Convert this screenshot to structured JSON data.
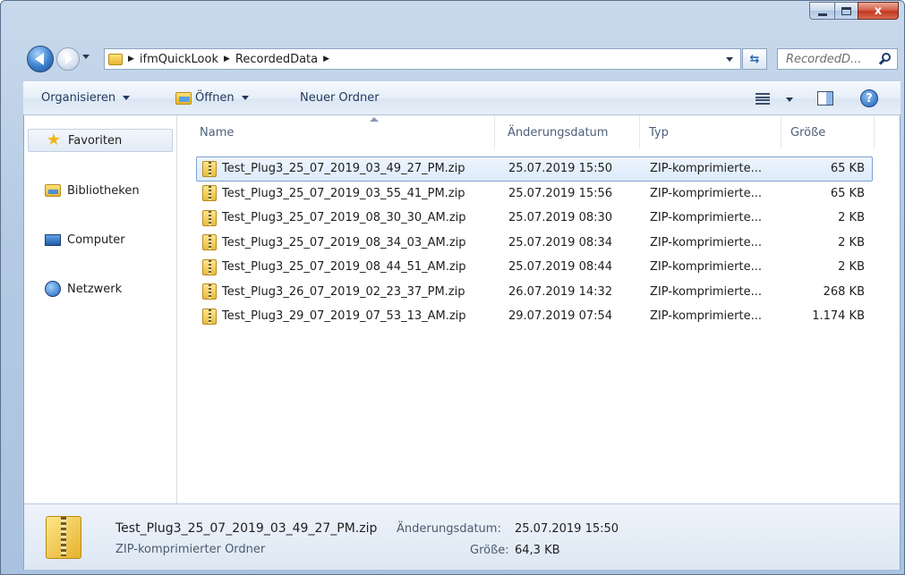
{
  "window": {
    "caption_close": "x"
  },
  "address_bar": {
    "crumbs": [
      "ifmQuickLook",
      "RecordedData"
    ],
    "search_placeholder": "RecordedD..."
  },
  "toolbar": {
    "organize_label": "Organisieren",
    "open_label": "Öffnen",
    "new_folder_label": "Neuer Ordner",
    "help_glyph": "?"
  },
  "nav_pane": {
    "items": [
      {
        "label": "Favoriten",
        "icon": "star-icon"
      },
      {
        "label": "Bibliotheken",
        "icon": "libraries-icon"
      },
      {
        "label": "Computer",
        "icon": "computer-icon"
      },
      {
        "label": "Netzwerk",
        "icon": "network-icon"
      }
    ]
  },
  "columns": {
    "name": "Name",
    "date": "Änderungsdatum",
    "type": "Typ",
    "size": "Größe"
  },
  "files": [
    {
      "name": "Test_Plug3_25_07_2019_03_49_27_PM.zip",
      "date": "25.07.2019 15:50",
      "type": "ZIP-komprimierte...",
      "size": "65 KB",
      "selected": true
    },
    {
      "name": "Test_Plug3_25_07_2019_03_55_41_PM.zip",
      "date": "25.07.2019 15:56",
      "type": "ZIP-komprimierte...",
      "size": "65 KB",
      "selected": false
    },
    {
      "name": "Test_Plug3_25_07_2019_08_30_30_AM.zip",
      "date": "25.07.2019 08:30",
      "type": "ZIP-komprimierte...",
      "size": "2 KB",
      "selected": false
    },
    {
      "name": "Test_Plug3_25_07_2019_08_34_03_AM.zip",
      "date": "25.07.2019 08:34",
      "type": "ZIP-komprimierte...",
      "size": "2 KB",
      "selected": false
    },
    {
      "name": "Test_Plug3_25_07_2019_08_44_51_AM.zip",
      "date": "25.07.2019 08:44",
      "type": "ZIP-komprimierte...",
      "size": "2 KB",
      "selected": false
    },
    {
      "name": "Test_Plug3_26_07_2019_02_23_37_PM.zip",
      "date": "26.07.2019 14:32",
      "type": "ZIP-komprimierte...",
      "size": "268 KB",
      "selected": false
    },
    {
      "name": "Test_Plug3_29_07_2019_07_53_13_AM.zip",
      "date": "29.07.2019 07:54",
      "type": "ZIP-komprimierte...",
      "size": "1.174 KB",
      "selected": false
    }
  ],
  "details": {
    "name": "Test_Plug3_25_07_2019_03_49_27_PM.zip",
    "type": "ZIP-komprimierter Ordner",
    "date_label": "Änderungsdatum:",
    "date_value": "25.07.2019 15:50",
    "size_label": "Größe:",
    "size_value": "64,3 KB"
  },
  "colors": {
    "selection_border": "#7da2ce",
    "frame": "#b5cbe4",
    "close_button": "#c4371f"
  }
}
